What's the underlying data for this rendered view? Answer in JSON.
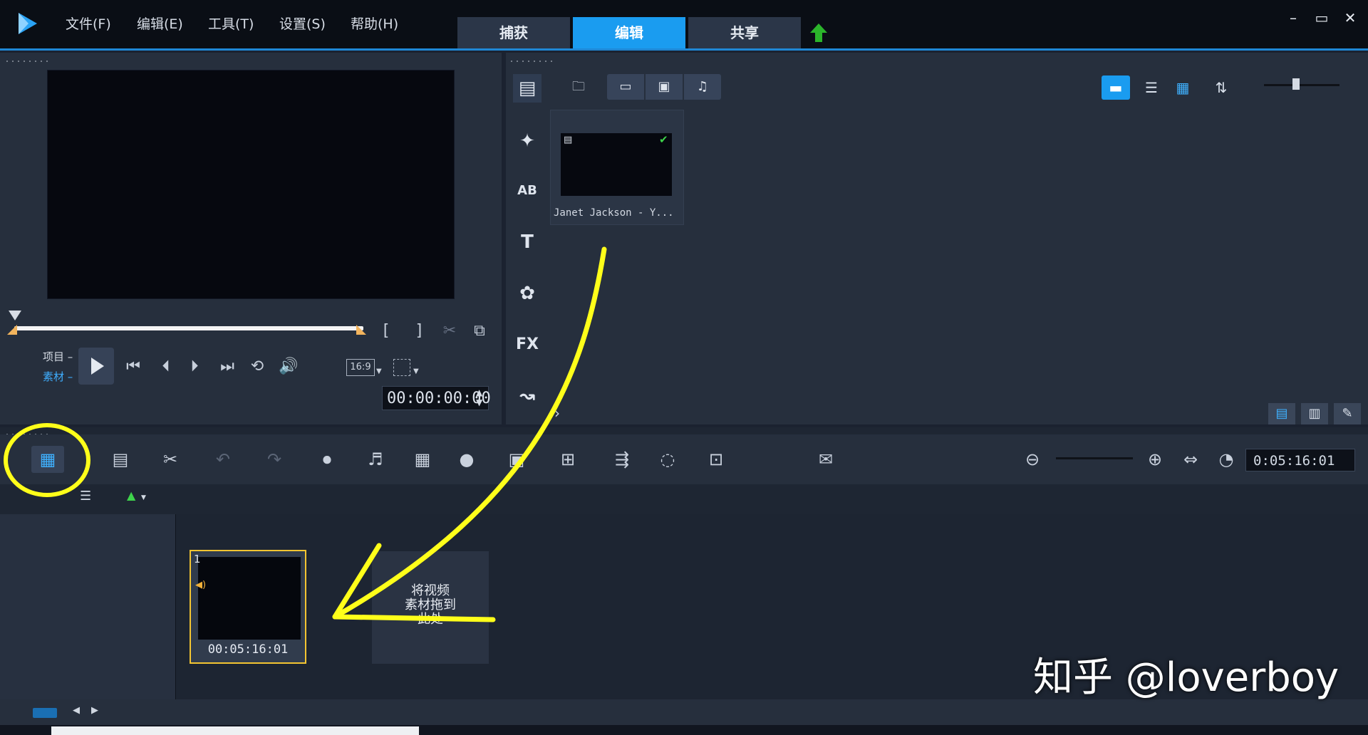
{
  "app": {
    "logo_icon": "play-logo-icon"
  },
  "menu": [
    "文件(F)",
    "编辑(E)",
    "工具(T)",
    "设置(S)",
    "帮助(H)"
  ],
  "workspace_tabs": [
    {
      "label": "捕获",
      "active": false
    },
    {
      "label": "编辑",
      "active": true
    },
    {
      "label": "共享",
      "active": false
    }
  ],
  "window_controls": {
    "minimize": "–",
    "maximize": "▭",
    "close": "✕"
  },
  "player": {
    "mode_project": "项目",
    "mode_clip": "素材",
    "aspect_ratio": "16:9",
    "bracket_in": "[",
    "bracket_out": "]",
    "timecode": "00:00:00:00"
  },
  "library": {
    "sidebar_fx": "FX",
    "sidebar_text": "T",
    "sidebar_ab": "AB",
    "media_item": {
      "name": "Janet Jackson - Y..."
    }
  },
  "timeline": {
    "duration": "0:05:16:01",
    "clip": {
      "index": "1",
      "duration": "00:05:16:01"
    },
    "drop_hint": "将视频\n素材拖到\n此处"
  },
  "watermark": "知乎 @loverboy",
  "colors": {
    "accent": "#1a9cf0",
    "highlight": "#f4c531",
    "annotation": "#ffff1a"
  }
}
